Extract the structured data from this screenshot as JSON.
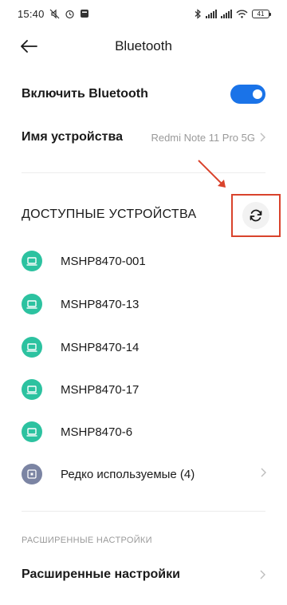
{
  "status_bar": {
    "time": "15:40",
    "battery": "41",
    "left_icons": [
      "mute-icon",
      "alarm-icon",
      "message-icon"
    ],
    "right_icons": [
      "bluetooth-icon",
      "signal-icon",
      "signal-icon",
      "wifi-icon",
      "battery-icon"
    ]
  },
  "header": {
    "title": "Bluetooth",
    "back_icon": "back-arrow-icon"
  },
  "settings": {
    "bluetooth_toggle_label": "Включить Bluetooth",
    "bluetooth_enabled": true,
    "device_name_label": "Имя устройства",
    "device_name_value": "Redmi Note 11 Pro 5G"
  },
  "available": {
    "title": "ДОСТУПНЫЕ УСТРОЙСТВА",
    "refresh_icon": "refresh-icon",
    "devices": [
      {
        "name": "MSHP8470-001",
        "icon": "laptop-icon"
      },
      {
        "name": "MSHP8470-13",
        "icon": "laptop-icon"
      },
      {
        "name": "MSHP8470-14",
        "icon": "laptop-icon"
      },
      {
        "name": "MSHP8470-17",
        "icon": "laptop-icon"
      },
      {
        "name": "MSHP8470-6",
        "icon": "laptop-icon"
      }
    ],
    "rarely_used_label": "Редко используемые (4)"
  },
  "advanced": {
    "section_title": "РАСШИРЕННЫЕ НАСТРОЙКИ",
    "item_label": "Расширенные настройки"
  },
  "colors": {
    "toggle_on": "#1a73e8",
    "device_icon": "#2cc2a0",
    "rare_icon": "#7b84a3",
    "annotation": "#d9432c"
  }
}
